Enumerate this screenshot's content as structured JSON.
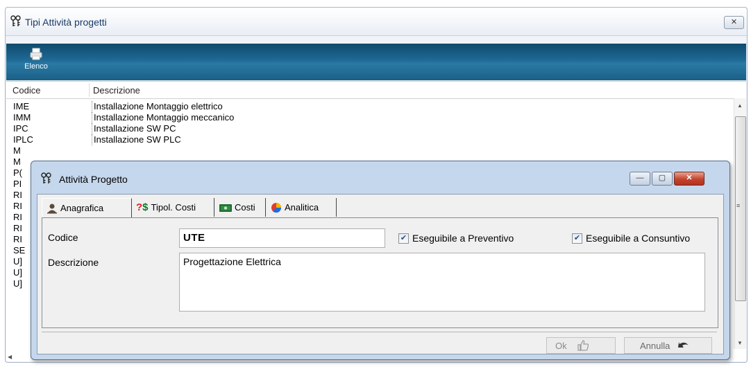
{
  "main_window": {
    "title": "Tipi Attività progetti",
    "close_label": "✕",
    "toolbar": {
      "elenco_label": "Elenco"
    },
    "list": {
      "headers": [
        "Codice",
        "Descrizione"
      ],
      "rows": [
        {
          "code": "IME",
          "desc": "Installazione Montaggio elettrico"
        },
        {
          "code": "IMM",
          "desc": "Installazione Montaggio meccanico"
        },
        {
          "code": "IPC",
          "desc": "Installazione SW PC"
        },
        {
          "code": "IPLC",
          "desc": "Installazione SW PLC"
        },
        {
          "code": "M",
          "desc": ""
        },
        {
          "code": "M",
          "desc": ""
        },
        {
          "code": "P(",
          "desc": ""
        },
        {
          "code": "PI",
          "desc": ""
        },
        {
          "code": "RI",
          "desc": ""
        },
        {
          "code": "RI",
          "desc": ""
        },
        {
          "code": "RI",
          "desc": ""
        },
        {
          "code": "RI",
          "desc": ""
        },
        {
          "code": "RI",
          "desc": ""
        },
        {
          "code": "SE",
          "desc": ""
        },
        {
          "code": "U]",
          "desc": ""
        },
        {
          "code": "U]",
          "desc": ""
        },
        {
          "code": "U]",
          "desc": ""
        }
      ]
    }
  },
  "dialog": {
    "title": "Attività Progetto",
    "tabs": [
      "Anagrafica",
      "Tipol. Costi",
      "Costi",
      "Analitica"
    ],
    "form": {
      "codice_label": "Codice",
      "codice_value": "UTE",
      "descrizione_label": "Descrizione",
      "descrizione_value": "Progettazione Elettrica",
      "chk_preventivo_label": "Eseguibile a Preventivo",
      "chk_consuntivo_label": "Eseguibile a Consuntivo",
      "chk_preventivo_checked": true,
      "chk_consuntivo_checked": true
    },
    "buttons": {
      "ok_label": "Ok",
      "annulla_label": "Annulla"
    }
  }
}
